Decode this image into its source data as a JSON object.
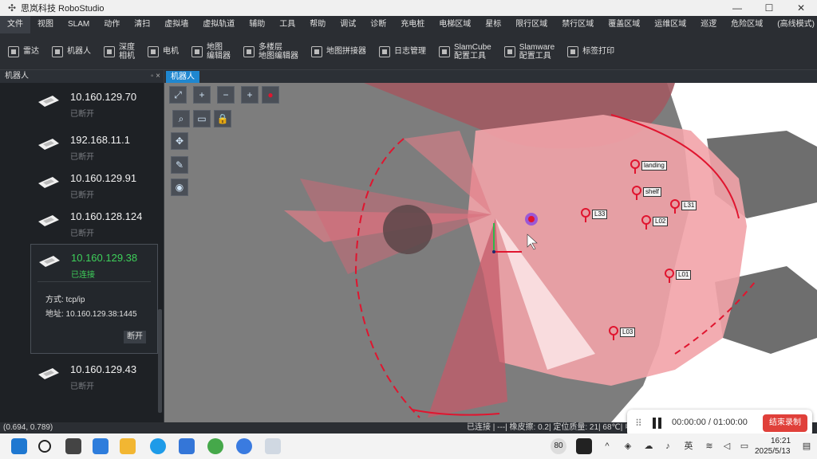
{
  "window": {
    "title": "思岚科技 RoboStudio",
    "controls": [
      "—",
      "☐",
      "✕"
    ]
  },
  "menubar": {
    "items": [
      "文件",
      "视图",
      "SLAM",
      "动作",
      "清扫",
      "虚拟墙",
      "虚拟轨道",
      "辅助",
      "工具",
      "帮助",
      "调试",
      "诊断",
      "充电桩",
      "电梯区域",
      "星标",
      "限行区域",
      "禁行区域",
      "覆盖区域",
      "运维区域",
      "巡逻",
      "危险区域",
      "(高线模式)"
    ]
  },
  "toolbar": {
    "items": [
      {
        "label": "雷达"
      },
      {
        "label": "机器人"
      },
      {
        "label": "深度\n相机"
      },
      {
        "label": "电机"
      },
      {
        "label": "地图\n编辑器"
      },
      {
        "label": "多楼层\n地图编辑器"
      },
      {
        "label": "地图拼接器"
      },
      {
        "label": "日志管理"
      },
      {
        "label": "SlamCube\n配置工具"
      },
      {
        "label": "Slamware\n配置工具"
      },
      {
        "label": "标签打印"
      }
    ]
  },
  "left_panel": {
    "title": "机器人",
    "header_controls": "◦ ×",
    "robots": [
      {
        "ip": "10.160.129.70",
        "state": "已断开"
      },
      {
        "ip": "192.168.11.1",
        "state": "已断开"
      },
      {
        "ip": "10.160.129.91",
        "state": "已断开"
      },
      {
        "ip": "10.160.128.124",
        "state": "已断开"
      },
      {
        "ip": "10.160.129.43",
        "state": "已断开"
      }
    ],
    "selected": {
      "ip": "10.160.129.38",
      "state": "已连接",
      "method": "方式: tcp/ip",
      "address": "地址: 10.160.129.38:1445",
      "disconnect_label": "断开"
    }
  },
  "map": {
    "tab_label": "机器人",
    "markers": [
      "landing",
      "shelf",
      "L33",
      "L02",
      "L01",
      "L03",
      "L31"
    ],
    "status_color": "#e0152f",
    "laser_color": "#f2a3a9"
  },
  "statusbar": {
    "coord": "(0.694, 0.789)",
    "status": "已连接 | ---| 橡皮擦: 0.2| 定位质量: 21| 68℃| 电"
  },
  "recorder": {
    "grip": "⠿",
    "time": "00:00:00 / 01:00:00",
    "stop_label": "结束录制"
  },
  "taskbar": {
    "tray_badge": "80",
    "ime": "英",
    "time": "16:21",
    "date": "2025/5/13"
  }
}
